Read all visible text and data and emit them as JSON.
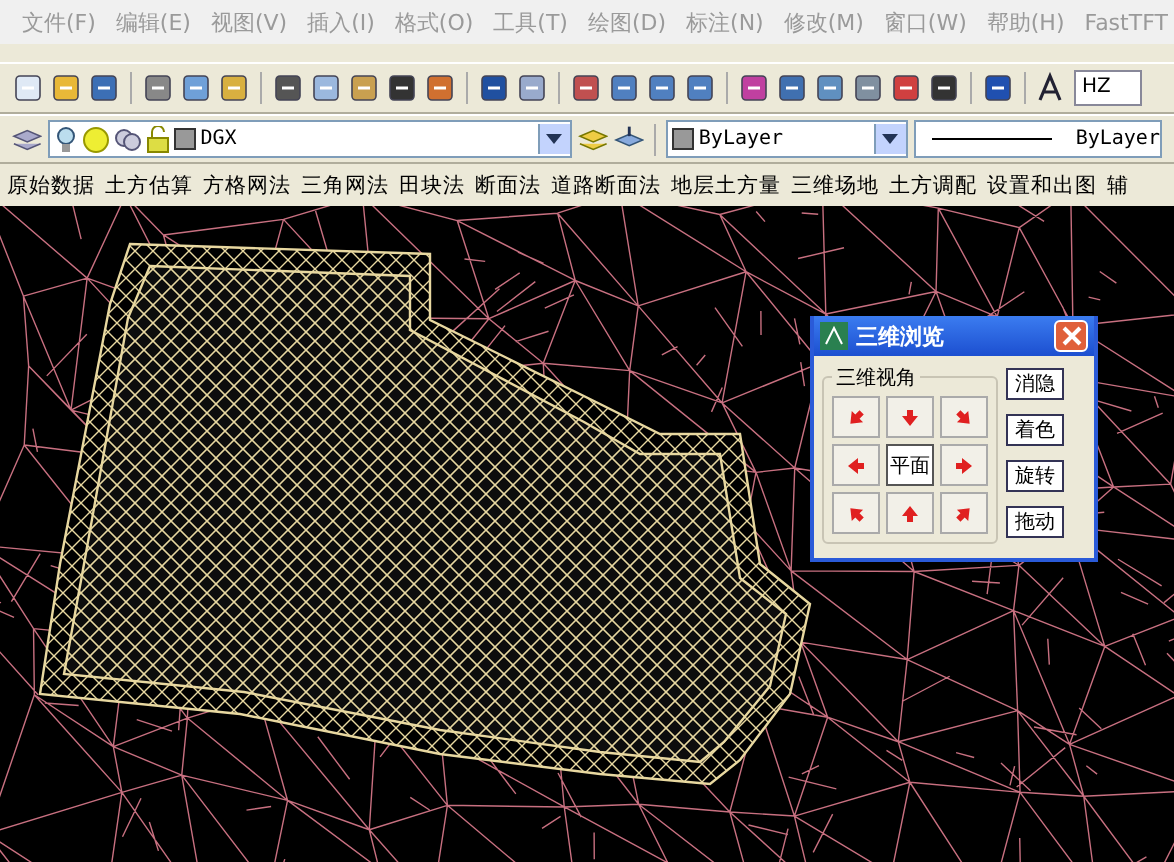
{
  "menu_bar": {
    "items": [
      "文件(F)",
      "编辑(E)",
      "视图(V)",
      "插入(I)",
      "格式(O)",
      "工具(T)",
      "绘图(D)",
      "标注(N)",
      "修改(M)",
      "窗口(W)",
      "帮助(H)",
      "FastTFT"
    ]
  },
  "standard_toolbar": {
    "text_style": "HZ"
  },
  "layer_toolbar": {
    "layer": "DGX",
    "color_setting": "ByLayer",
    "linetype": "ByLayer"
  },
  "function_menu": {
    "items": [
      "原始数据",
      "土方估算",
      "方格网法",
      "三角网法",
      "田块法",
      "断面法",
      "道路断面法",
      "地层土方量",
      "三维场地",
      "土方调配",
      "设置和出图",
      "辅"
    ]
  },
  "dialog": {
    "title": "三维浏览",
    "group_title": "三维视角",
    "center_button": "平面",
    "buttons": [
      "消隐",
      "着色",
      "旋转",
      "拖动"
    ]
  }
}
